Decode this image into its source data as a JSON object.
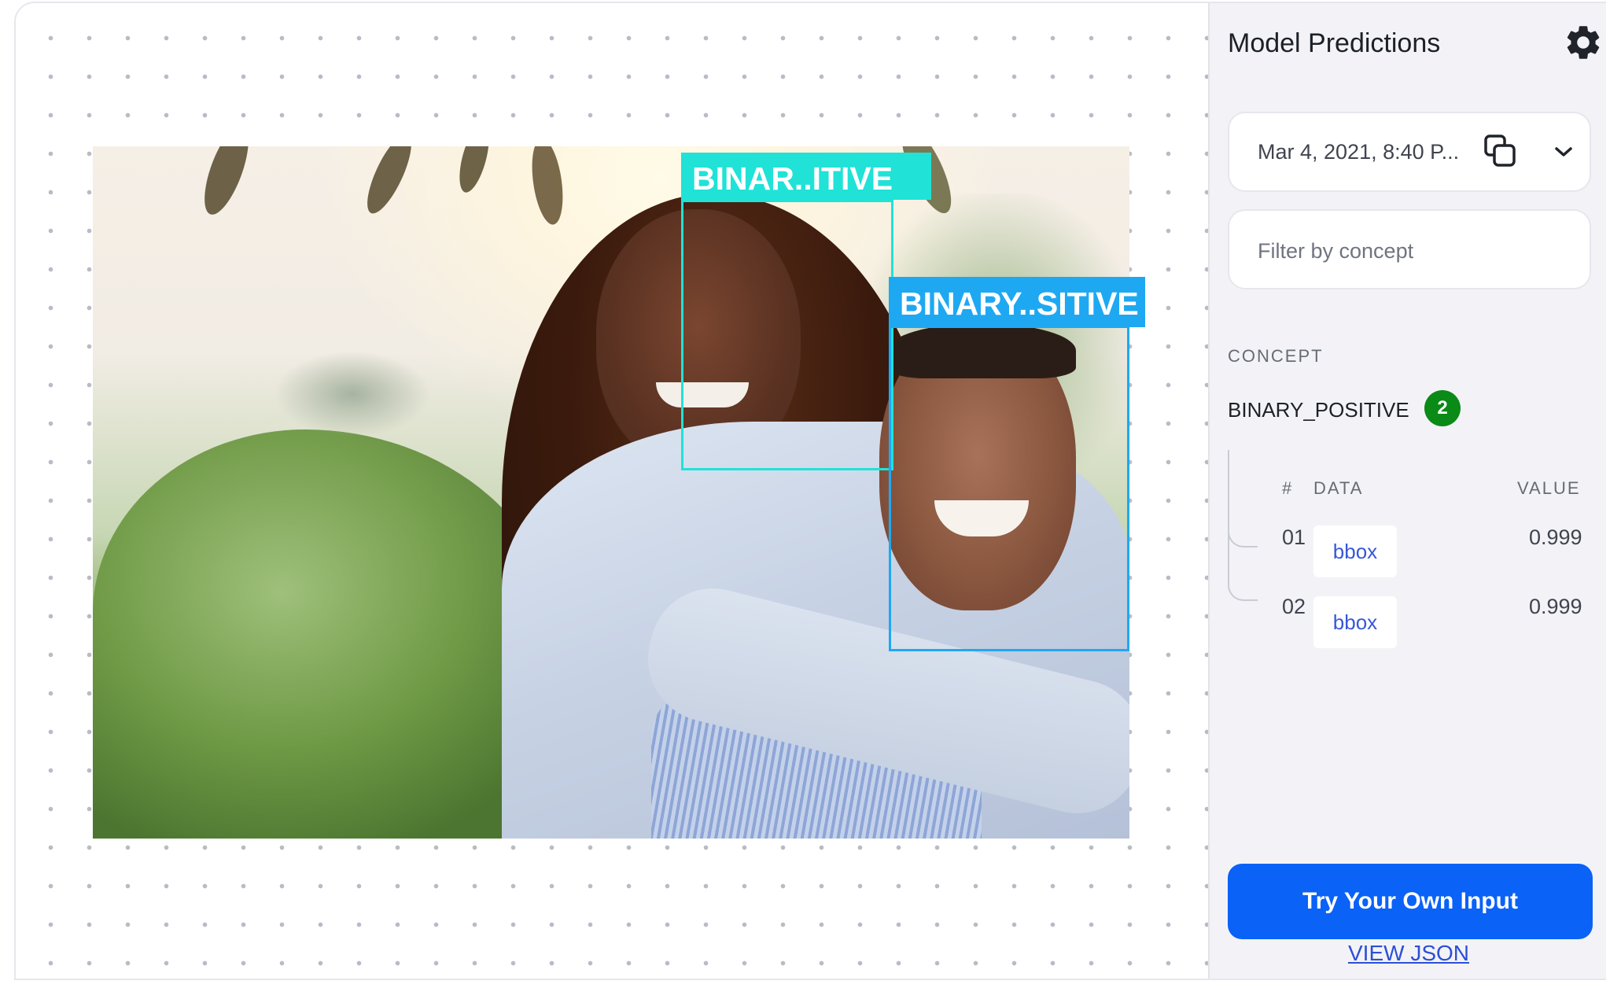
{
  "canvas": {
    "detections": [
      {
        "label": "BINAR..ITIVE",
        "color": "#20e2d7"
      },
      {
        "label": "BINARY..SITIVE",
        "color": "#1fa8f2"
      }
    ]
  },
  "panel": {
    "title": "Model Predictions",
    "settings_icon": "gear-icon",
    "version_select": {
      "value": "Mar 4, 2021, 8:40 P...",
      "copy_icon": "copy-icon",
      "dropdown_icon": "chevron-down-icon"
    },
    "filter": {
      "placeholder": "Filter by concept",
      "value": ""
    },
    "concept_heading": "CONCEPT",
    "concept": {
      "name": "BINARY_POSITIVE",
      "count": "2",
      "badge_color": "#0a8a16"
    },
    "table": {
      "headers": {
        "num": "#",
        "data": "DATA",
        "value": "VALUE"
      },
      "rows": [
        {
          "num": "01",
          "data": "bbox",
          "value": "0.999"
        },
        {
          "num": "02",
          "data": "bbox",
          "value": "0.999"
        }
      ]
    },
    "primary_button": "Try Your Own Input",
    "json_link": "VIEW JSON",
    "accent_color": "#0a62f7"
  }
}
